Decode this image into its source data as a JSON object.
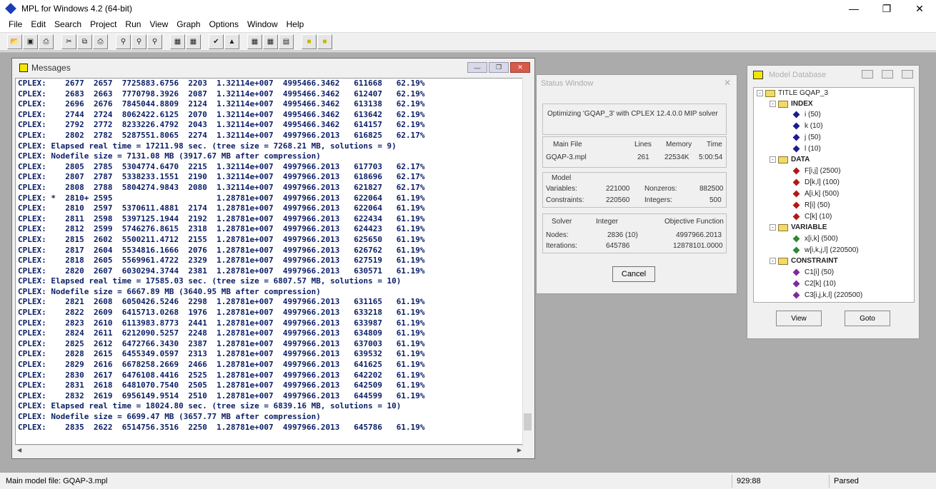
{
  "app": {
    "title": "MPL for Windows 4.2 (64-bit)"
  },
  "menu": [
    "File",
    "Edit",
    "Search",
    "Project",
    "Run",
    "View",
    "Graph",
    "Options",
    "Window",
    "Help"
  ],
  "toolbar_icons": [
    "open-icon",
    "save-icon",
    "print-icon",
    "cut-icon",
    "copy-icon",
    "paste-icon",
    "find-icon",
    "find-next-icon",
    "replace-icon",
    "parse-icon",
    "compile-icon",
    "run-icon",
    "graph-icon",
    "matrix-icon",
    "view-icon",
    "db-icon",
    "status-icon"
  ],
  "messages_window": {
    "title": "Messages",
    "lines": [
      "CPLEX:    2677  2657  7725883.6756  2203  1.32114e+007  4995466.3462   611668   62.19%",
      "CPLEX:    2683  2663  7770798.3926  2087  1.32114e+007  4995466.3462   612407   62.19%",
      "CPLEX:    2696  2676  7845044.8809  2124  1.32114e+007  4995466.3462   613138   62.19%",
      "CPLEX:    2744  2724  8062422.6125  2070  1.32114e+007  4995466.3462   613642   62.19%",
      "CPLEX:    2792  2772  8233226.4792  2043  1.32114e+007  4995466.3462   614157   62.19%",
      "CPLEX:    2802  2782  5287551.8065  2274  1.32114e+007  4997966.2013   616825   62.17%",
      "CPLEX: Elapsed real time = 17211.98 sec. (tree size = 7268.21 MB, solutions = 9)",
      "CPLEX: Nodefile size = 7131.08 MB (3917.67 MB after compression)",
      "CPLEX:    2805  2785  5304774.6470  2215  1.32114e+007  4997966.2013   617703   62.17%",
      "CPLEX:    2807  2787  5338233.1551  2190  1.32114e+007  4997966.2013   618696   62.17%",
      "CPLEX:    2808  2788  5804274.9843  2080  1.32114e+007  4997966.2013   621827   62.17%",
      "CPLEX: *  2810+ 2595                      1.28781e+007  4997966.2013   622064   61.19%",
      "CPLEX:    2810  2597  5370611.4881  2174  1.28781e+007  4997966.2013   622064   61.19%",
      "CPLEX:    2811  2598  5397125.1944  2192  1.28781e+007  4997966.2013   622434   61.19%",
      "CPLEX:    2812  2599  5746276.8615  2318  1.28781e+007  4997966.2013   624423   61.19%",
      "CPLEX:    2815  2602  5500211.4712  2155  1.28781e+007  4997966.2013   625650   61.19%",
      "CPLEX:    2817  2604  5534816.1666  2076  1.28781e+007  4997966.2013   626762   61.19%",
      "CPLEX:    2818  2605  5569961.4722  2329  1.28781e+007  4997966.2013   627519   61.19%",
      "CPLEX:    2820  2607  6030294.3744  2381  1.28781e+007  4997966.2013   630571   61.19%",
      "CPLEX: Elapsed real time = 17585.03 sec. (tree size = 6807.57 MB, solutions = 10)",
      "CPLEX: Nodefile size = 6667.89 MB (3640.95 MB after compression)",
      "CPLEX:    2821  2608  6050426.5246  2298  1.28781e+007  4997966.2013   631165   61.19%",
      "CPLEX:    2822  2609  6415713.0268  1976  1.28781e+007  4997966.2013   633218   61.19%",
      "CPLEX:    2823  2610  6113983.8773  2441  1.28781e+007  4997966.2013   633987   61.19%",
      "CPLEX:    2824  2611  6212090.5257  2248  1.28781e+007  4997966.2013   634809   61.19%",
      "CPLEX:    2825  2612  6472766.3430  2387  1.28781e+007  4997966.2013   637003   61.19%",
      "CPLEX:    2828  2615  6455349.0597  2313  1.28781e+007  4997966.2013   639532   61.19%",
      "CPLEX:    2829  2616  6678258.2669  2466  1.28781e+007  4997966.2013   641625   61.19%",
      "CPLEX:    2830  2617  6476108.4416  2525  1.28781e+007  4997966.2013   642202   61.19%",
      "CPLEX:    2831  2618  6481070.7540  2505  1.28781e+007  4997966.2013   642509   61.19%",
      "CPLEX:    2832  2619  6956149.9514  2510  1.28781e+007  4997966.2013   644599   61.19%",
      "CPLEX: Elapsed real time = 18024.80 sec. (tree size = 6839.16 MB, solutions = 10)",
      "CPLEX: Nodefile size = 6699.47 MB (3657.77 MB after compression)",
      "CPLEX:    2835  2622  6514756.3516  2250  1.28781e+007  4997966.2013   645786   61.19%"
    ]
  },
  "status_window": {
    "title": "Status Window",
    "message": "Optimizing 'GQAP_3' with CPLEX 12.4.0.0 MIP solver",
    "file_group": {
      "headers": [
        "Main File",
        "Lines",
        "Memory",
        "Time"
      ],
      "values": [
        "GQAP-3.mpl",
        "261",
        "22534K",
        "5:00:54"
      ]
    },
    "model_group": {
      "header": "Model",
      "rows": [
        [
          "Variables:",
          "221000",
          "Nonzeros:",
          "882500"
        ],
        [
          "Constraints:",
          "220560",
          "Integers:",
          "500"
        ]
      ]
    },
    "solver_group": {
      "headers": [
        "Solver",
        "Integer",
        "Objective Function"
      ],
      "rows": [
        [
          "Nodes:",
          "2836  (10)",
          "4997966.2013"
        ],
        [
          "Iterations:",
          "645786",
          "12878101.0000"
        ]
      ]
    },
    "cancel_label": "Cancel"
  },
  "db_window": {
    "title": "Model Database",
    "tree": {
      "root": "TITLE GQAP_3",
      "sections": [
        {
          "label": "INDEX",
          "items": [
            "i   (50)",
            "k   (10)",
            "j   (50)",
            "l   (10)"
          ]
        },
        {
          "label": "DATA",
          "items": [
            "F[i,j]   (2500)",
            "D[k,l]   (100)",
            "A[i,k]   (500)",
            "R[i]   (50)",
            "C[k]   (10)"
          ]
        },
        {
          "label": "VARIABLE",
          "items": [
            "x[i,k]   (500)",
            "w[i,k,j,l]   (220500)"
          ]
        },
        {
          "label": "CONSTRAINT",
          "items": [
            "C1[i]   (50)",
            "C2[k]   (10)",
            "C3[i,j,k,l]   (220500)"
          ]
        }
      ]
    },
    "view_label": "View",
    "goto_label": "Goto"
  },
  "statusbar": {
    "file": "Main model file: GQAP-3.mpl",
    "position": "929:88",
    "state": "Parsed"
  }
}
